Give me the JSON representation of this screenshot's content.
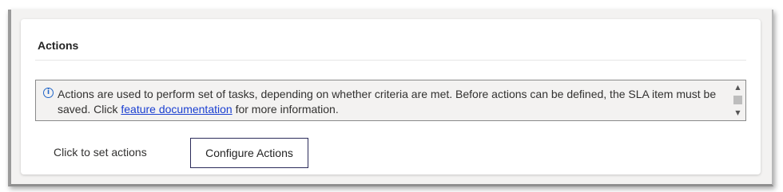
{
  "section": {
    "title": "Actions"
  },
  "info": {
    "icon": "info-icon",
    "icon_glyph": "i",
    "text_before": "Actions are used to perform set of tasks, depending on whether criteria are met. Before actions can be defined, the SLA item must be saved. Click ",
    "link_text": "feature documentation",
    "text_after": " for more information.",
    "scroll_up_glyph": "▲",
    "scroll_down_glyph": "▼"
  },
  "actions": {
    "label": "Click to set actions",
    "button_label": "Configure Actions"
  },
  "colors": {
    "link": "#1a3fd1",
    "info_icon": "#2266c8",
    "button_border": "#2b2b5a",
    "info_background": "#f3f2f1"
  }
}
